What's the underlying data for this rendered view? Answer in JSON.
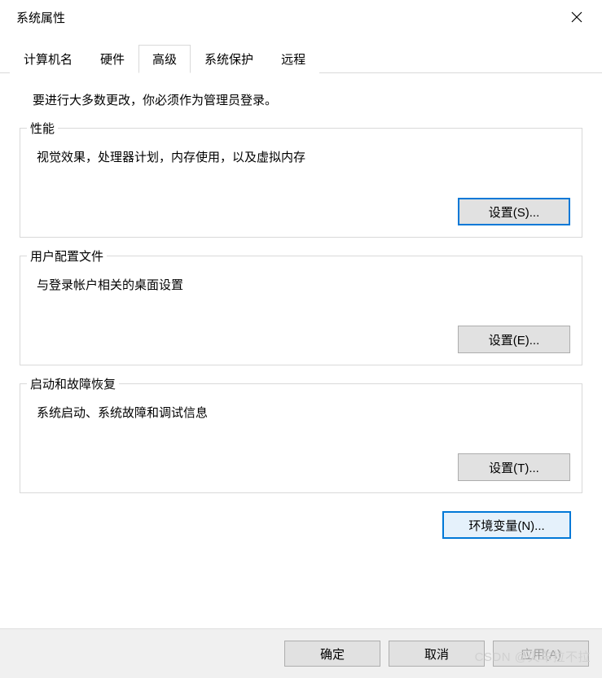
{
  "window": {
    "title": "系统属性"
  },
  "tabs": [
    {
      "label": "计算机名"
    },
    {
      "label": "硬件"
    },
    {
      "label": "高级"
    },
    {
      "label": "系统保护"
    },
    {
      "label": "远程"
    }
  ],
  "content": {
    "intro": "要进行大多数更改，你必须作为管理员登录。",
    "groups": {
      "performance": {
        "title": "性能",
        "desc": "视觉效果，处理器计划，内存使用，以及虚拟内存",
        "button": "设置(S)..."
      },
      "userprofile": {
        "title": "用户配置文件",
        "desc": "与登录帐户相关的桌面设置",
        "button": "设置(E)..."
      },
      "startup": {
        "title": "启动和故障恢复",
        "desc": "系统启动、系统故障和调试信息",
        "button": "设置(T)..."
      }
    },
    "env_button": "环境变量(N)..."
  },
  "dialog_buttons": {
    "ok": "确定",
    "cancel": "取消",
    "apply": "应用(A)"
  },
  "watermark": "CSDN @火车拉不拉"
}
